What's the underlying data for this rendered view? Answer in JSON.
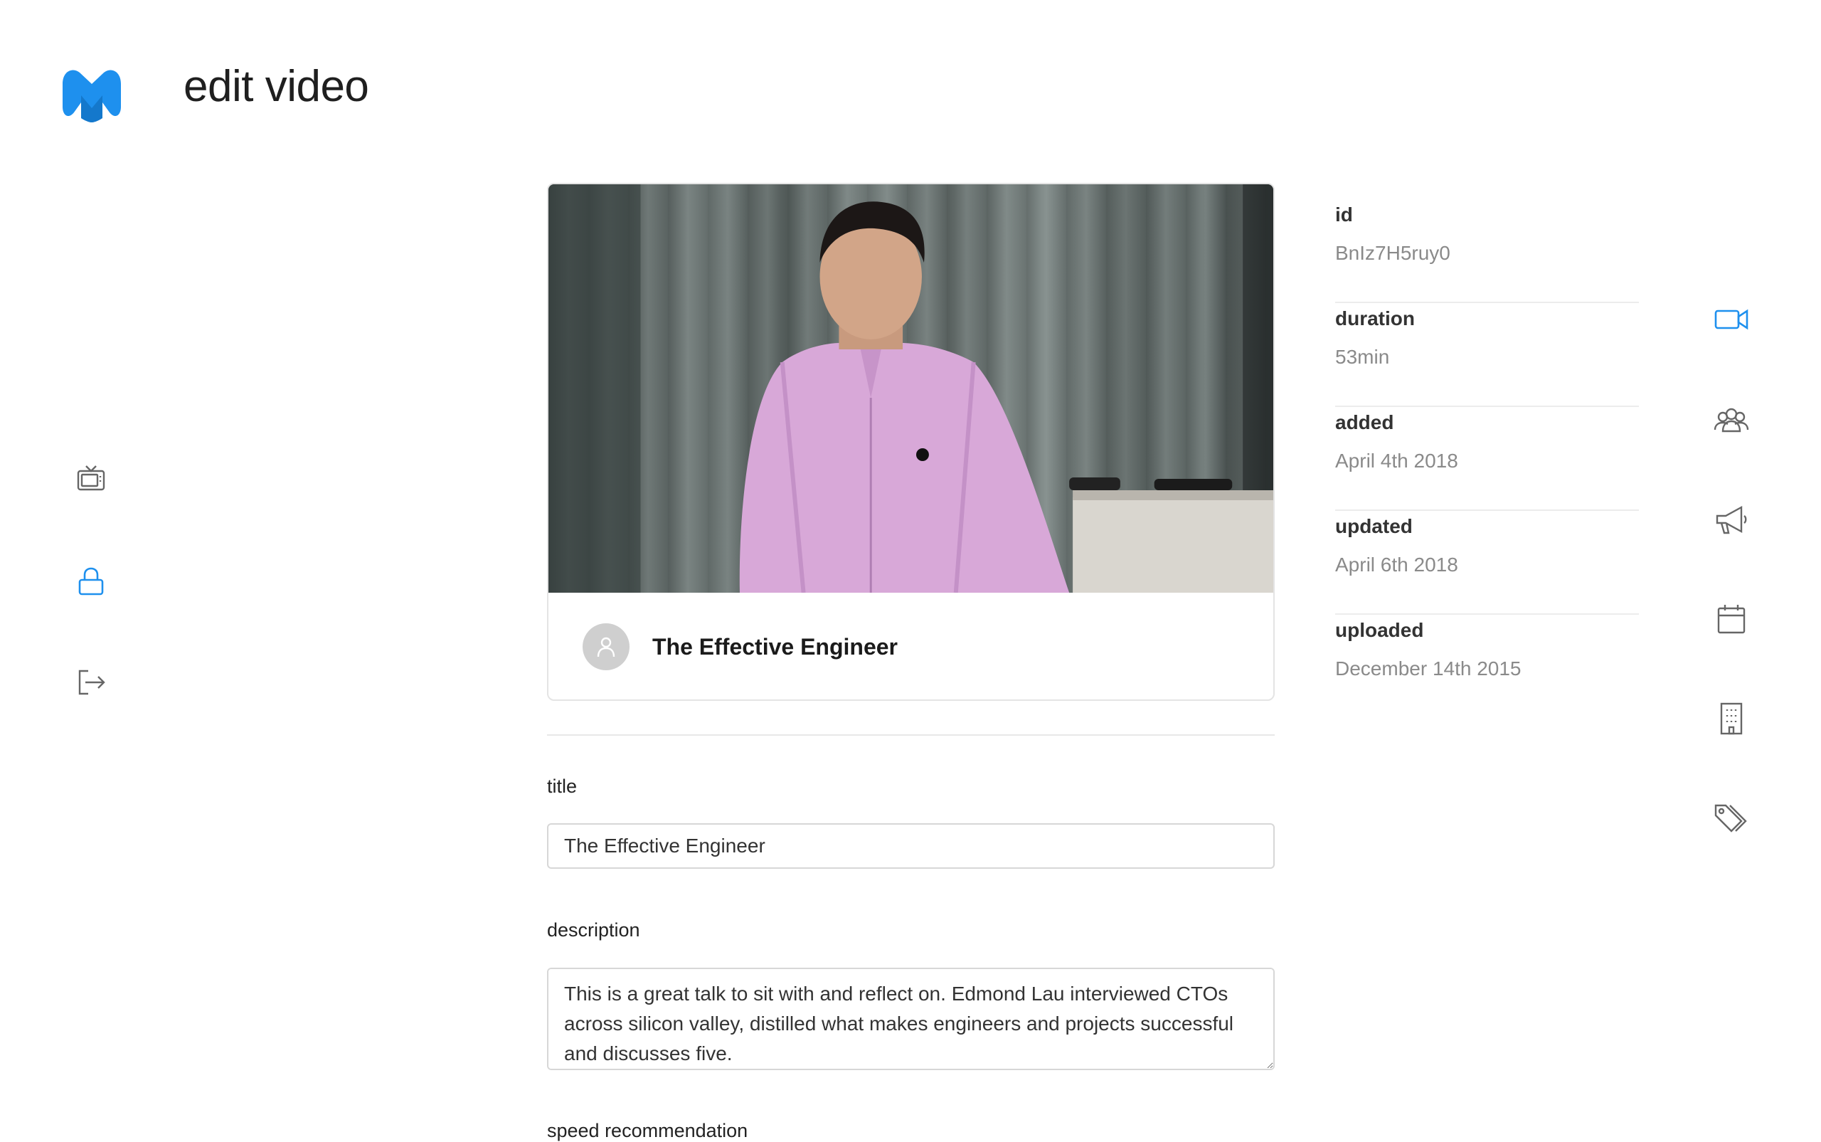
{
  "header": {
    "title": "edit video"
  },
  "left_nav": {
    "items": [
      {
        "icon": "tv-icon",
        "active": false
      },
      {
        "icon": "lock-icon",
        "active": true
      },
      {
        "icon": "logout-icon",
        "active": false
      }
    ]
  },
  "right_nav": {
    "items": [
      {
        "icon": "video-camera-icon",
        "active": true
      },
      {
        "icon": "users-icon",
        "active": false
      },
      {
        "icon": "megaphone-icon",
        "active": false
      },
      {
        "icon": "calendar-icon",
        "active": false
      },
      {
        "icon": "building-icon",
        "active": false
      },
      {
        "icon": "tags-icon",
        "active": false
      }
    ]
  },
  "video_card": {
    "title": "The Effective Engineer"
  },
  "form": {
    "title_label": "title",
    "title_value": "The Effective Engineer",
    "description_label": "description",
    "description_value": "This is a great talk to sit with and reflect on. Edmond Lau interviewed CTOs across silicon valley, distilled what makes engineers and projects successful and discusses five.",
    "speed_label": "speed recommendation"
  },
  "meta": {
    "id_label": "id",
    "id_value": "BnIz7H5ruy0",
    "duration_label": "duration",
    "duration_value": "53min",
    "added_label": "added",
    "added_value": "April 4th 2018",
    "updated_label": "updated",
    "updated_value": "April 6th 2018",
    "uploaded_label": "uploaded",
    "uploaded_value": "December 14th 2015"
  },
  "colors": {
    "accent": "#1e90ee",
    "icon_gray": "#666666"
  }
}
